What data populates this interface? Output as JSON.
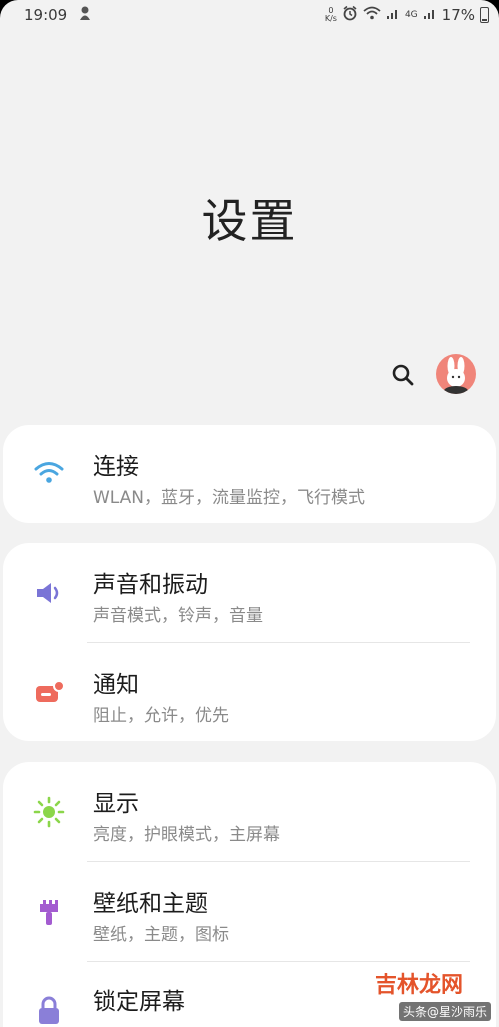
{
  "status_bar": {
    "time": "19:09",
    "net_speed_top": "0",
    "net_speed_bottom": "K/s",
    "network_type": "4G",
    "battery": "17%"
  },
  "page_title": "设置",
  "sections": [
    {
      "items": [
        {
          "title": "连接",
          "subtitle": "WLAN，蓝牙，流量监控，飞行模式",
          "icon": "wifi-icon",
          "color": "#4aa6e0"
        }
      ]
    },
    {
      "items": [
        {
          "title": "声音和振动",
          "subtitle": "声音模式，铃声，音量",
          "icon": "speaker-icon",
          "color": "#7a74d6"
        },
        {
          "title": "通知",
          "subtitle": "阻止，允许，优先",
          "icon": "notification-icon",
          "color": "#ee6b5d"
        }
      ]
    },
    {
      "items": [
        {
          "title": "显示",
          "subtitle": "亮度，护眼模式，主屏幕",
          "icon": "brightness-icon",
          "color": "#8bd64a"
        },
        {
          "title": "壁纸和主题",
          "subtitle": "壁纸，主题，图标",
          "icon": "brush-icon",
          "color": "#a35bd0"
        },
        {
          "title": "锁定屏幕",
          "subtitle": "",
          "icon": "lock-icon",
          "color": "#8a7fd8"
        }
      ]
    }
  ],
  "watermark": {
    "main": "吉林龙网",
    "sub": "头条@星沙雨乐"
  }
}
